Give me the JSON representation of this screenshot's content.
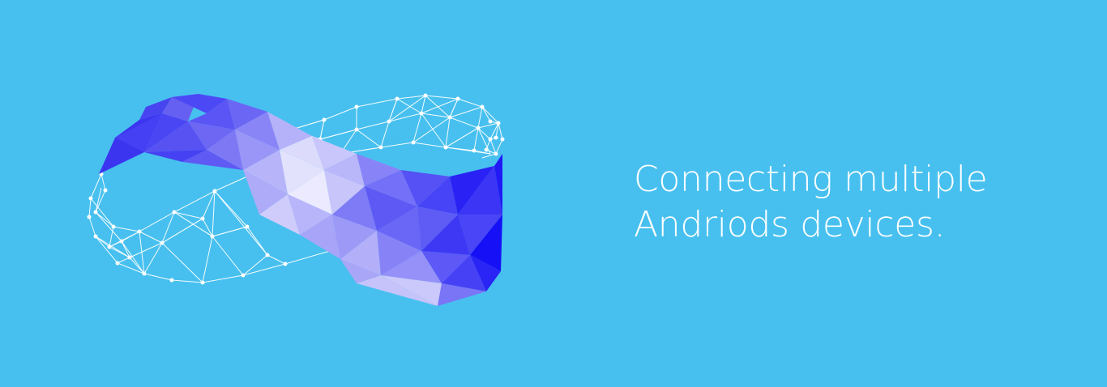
{
  "banner": {
    "headline_line1": "Connecting multiple",
    "headline_line2": "Andriods devices.",
    "background_color": "#47c0ef",
    "text_color": "#ffffff",
    "illustration": "infinity-lowpoly-mesh-illustration"
  }
}
